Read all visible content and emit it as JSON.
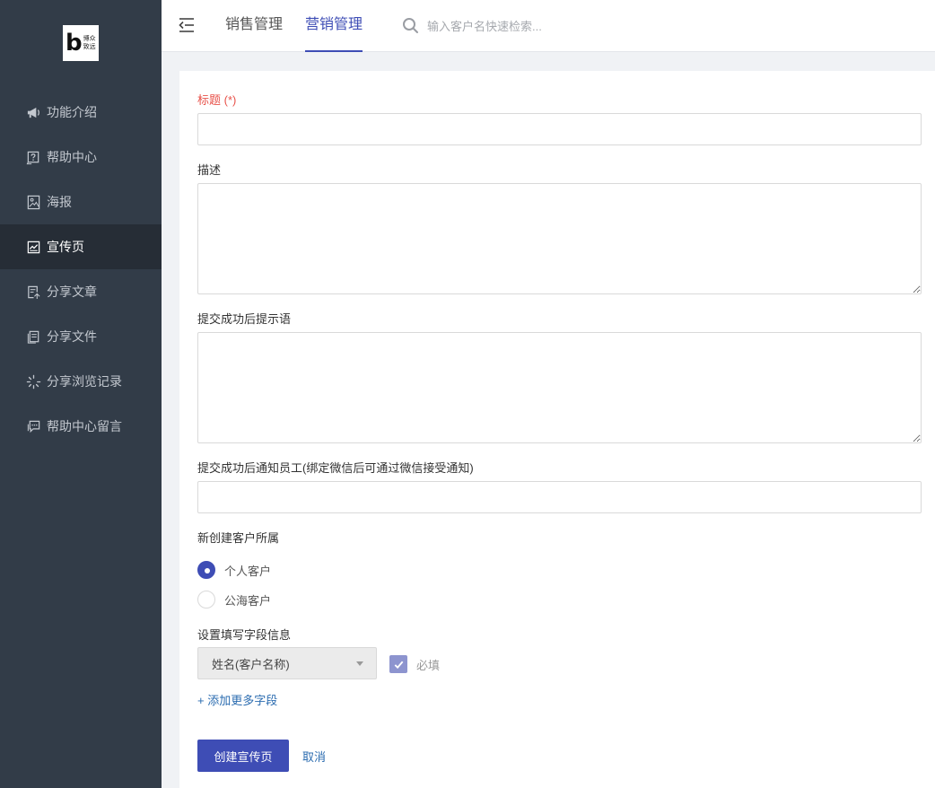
{
  "sidebar": {
    "logo_letter": "b",
    "logo_text_line1": "博众",
    "logo_text_line2": "致远",
    "items": [
      {
        "label": "功能介绍",
        "icon": "megaphone-icon"
      },
      {
        "label": "帮助中心",
        "icon": "help-icon"
      },
      {
        "label": "海报",
        "icon": "poster-icon"
      },
      {
        "label": "宣传页",
        "icon": "chart-page-icon",
        "active": true
      },
      {
        "label": "分享文章",
        "icon": "share-article-icon"
      },
      {
        "label": "分享文件",
        "icon": "share-file-icon"
      },
      {
        "label": "分享浏览记录",
        "icon": "loading-icon"
      },
      {
        "label": "帮助中心留言",
        "icon": "message-icon"
      }
    ]
  },
  "header": {
    "tabs": [
      {
        "label": "销售管理"
      },
      {
        "label": "营销管理",
        "active": true
      }
    ],
    "search_placeholder": "输入客户名快速检索..."
  },
  "form": {
    "title_label": "标题 (*)",
    "title_value": "",
    "description_label": "描述",
    "description_value": "",
    "success_message_label": "提交成功后提示语",
    "success_message_value": "",
    "notify_staff_label": "提交成功后通知员工(绑定微信后可通过微信接受通知)",
    "notify_staff_value": "",
    "customer_owner_label": "新创建客户所属",
    "options": [
      {
        "label": "个人客户",
        "checked": true
      },
      {
        "label": "公海客户",
        "checked": false
      }
    ],
    "field_settings_label": "设置填写字段信息",
    "field_select_value": "姓名(客户名称)",
    "required_label": "必填",
    "required_checked": true,
    "add_field_label": "+ 添加更多字段",
    "submit_label": "创建宣传页",
    "cancel_label": "取消"
  },
  "colors": {
    "sidebar_bg": "#323c48",
    "sidebar_active_bg": "#262d36",
    "accent": "#3e4db5",
    "required_red": "#e8524a",
    "link": "#2b6cb0"
  }
}
